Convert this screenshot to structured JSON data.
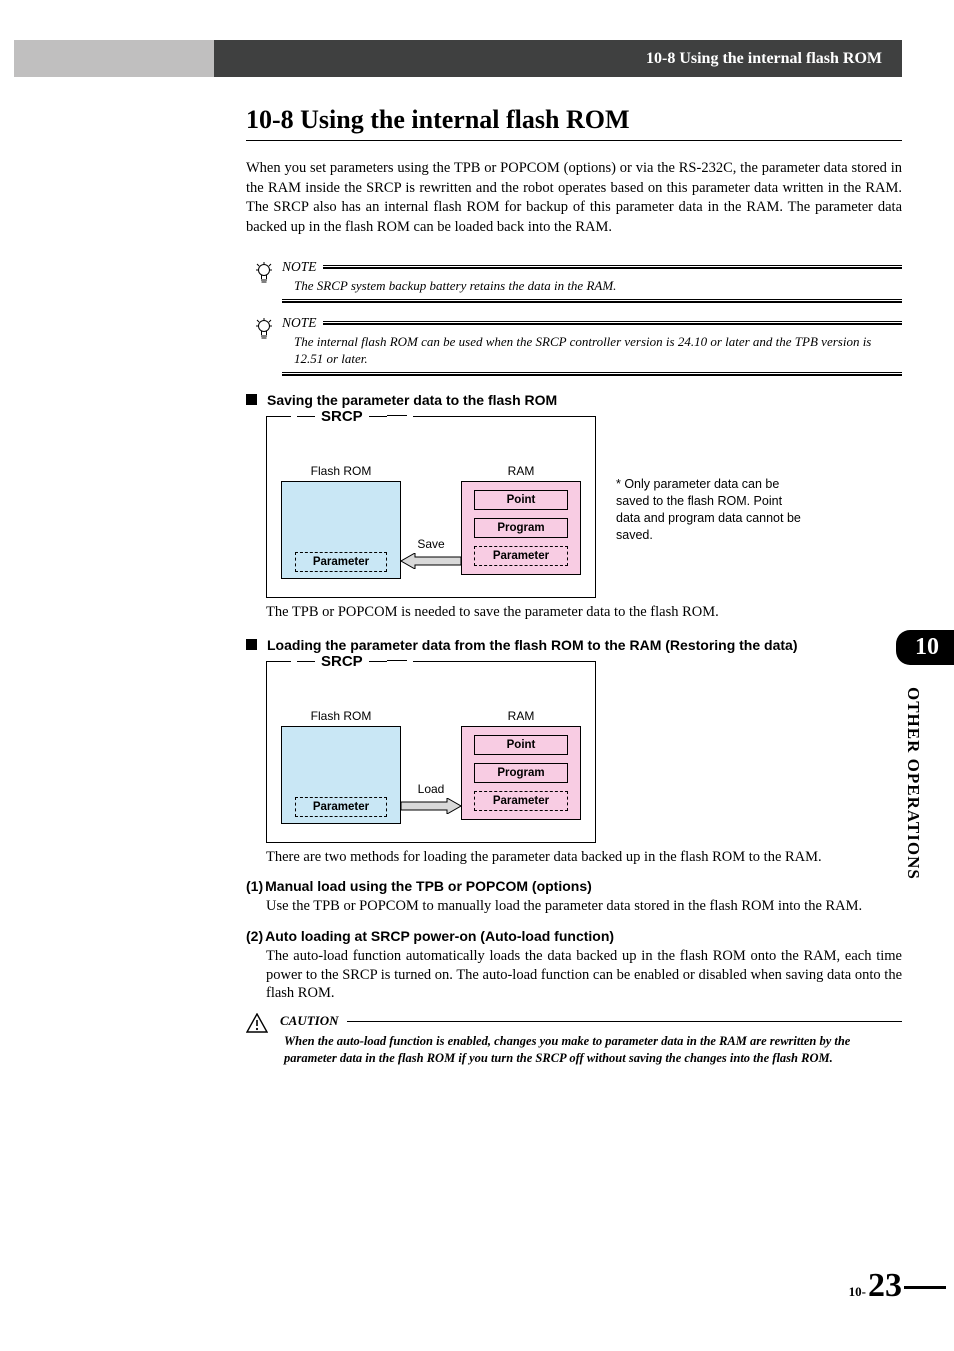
{
  "header": {
    "breadcrumb": "10-8 Using the internal flash ROM"
  },
  "title": "10-8  Using the internal flash ROM",
  "intro": "When you set parameters using the TPB or POPCOM (options) or via the RS-232C, the parameter data stored in the RAM inside the SRCP is rewritten and the robot operates based on this parameter data written in the RAM. The SRCP also has an internal flash ROM for backup of this parameter data in the RAM. The parameter data backed up in the flash ROM can be loaded back into the RAM.",
  "notes": [
    {
      "label": "NOTE",
      "text": "The SRCP system backup battery retains the data in the RAM."
    },
    {
      "label": "NOTE",
      "text": "The internal flash ROM can be used when the SRCP controller version is 24.10 or later and the TPB version is 12.51 or later."
    }
  ],
  "section_save": {
    "heading": "Saving the parameter data to the flash ROM",
    "diagram": {
      "title": "SRCP",
      "flash_label": "Flash ROM",
      "flash_cell": "Parameter",
      "ram_label": "RAM",
      "ram_cells": [
        "Point",
        "Program",
        "Parameter"
      ],
      "arrow_label": "Save"
    },
    "side_note": "* Only parameter data can be saved to the flash ROM. Point data and program data cannot be saved.",
    "caption": "The TPB or POPCOM is needed to save the parameter data to the flash ROM."
  },
  "section_load": {
    "heading": "Loading the parameter data from the flash ROM to the RAM (Restoring the data)",
    "diagram": {
      "title": "SRCP",
      "flash_label": "Flash ROM",
      "flash_cell": "Parameter",
      "ram_label": "RAM",
      "ram_cells": [
        "Point",
        "Program",
        "Parameter"
      ],
      "arrow_label": "Load"
    },
    "caption": "There are two methods for loading the parameter data backed up in the flash ROM to the RAM.",
    "items": [
      {
        "num": "(1)",
        "head": "Manual load using the TPB or POPCOM (options)",
        "text": "Use the TPB or POPCOM to manually load the parameter data stored in the flash ROM into the RAM."
      },
      {
        "num": "(2)",
        "head": "Auto loading at SRCP power-on (Auto-load function)",
        "text": "The auto-load function automatically loads the data backed up in the flash ROM onto the RAM, each time power to the SRCP is turned on. The auto-load function can be enabled or disabled when saving data onto the flash ROM."
      }
    ]
  },
  "caution": {
    "label": "CAUTION",
    "text": "When the auto-load function is enabled, changes you make to parameter data in the RAM are rewritten by the parameter data in the flash ROM if you turn the SRCP off without saving the changes into the flash ROM."
  },
  "side_tab": {
    "number": "10",
    "label": "OTHER OPERATIONS"
  },
  "footer": {
    "prefix": "10-",
    "page": "23"
  }
}
